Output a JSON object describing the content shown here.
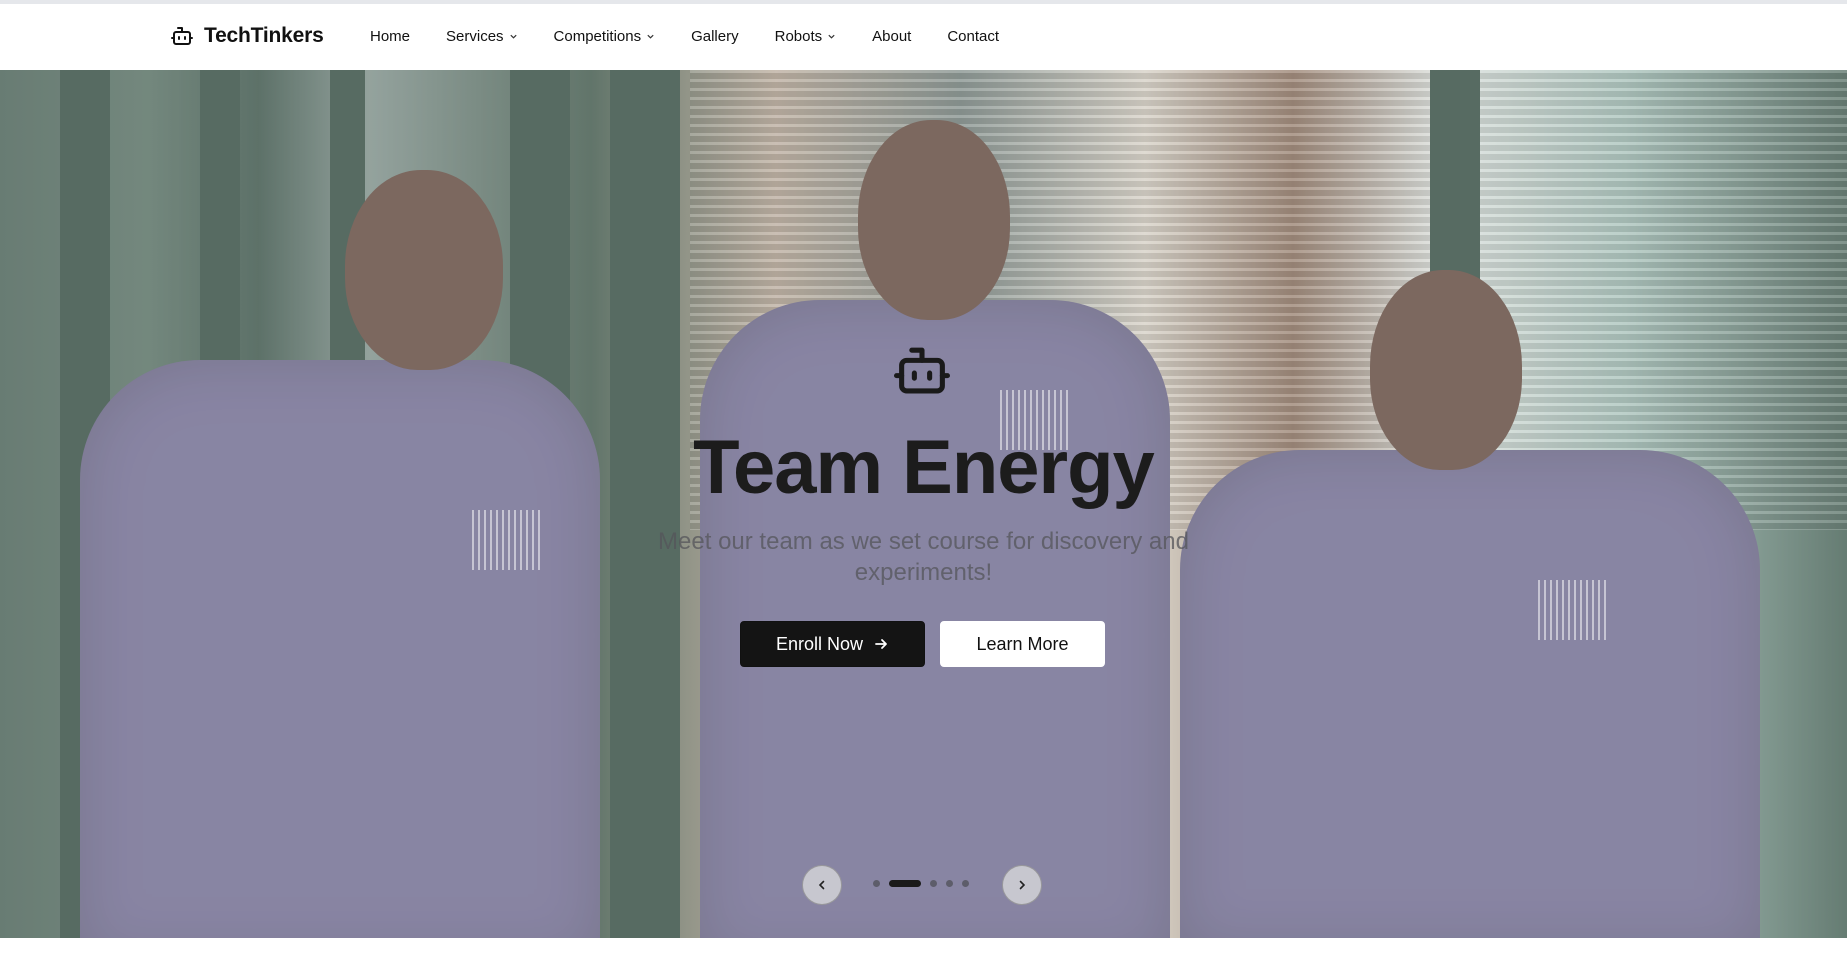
{
  "brand": {
    "name": "TechTinkers",
    "icon": "robot-icon"
  },
  "nav": {
    "items": [
      {
        "label": "Home",
        "has_dropdown": false
      },
      {
        "label": "Services",
        "has_dropdown": true
      },
      {
        "label": "Competitions",
        "has_dropdown": true
      },
      {
        "label": "Gallery",
        "has_dropdown": false
      },
      {
        "label": "Robots",
        "has_dropdown": true
      },
      {
        "label": "About",
        "has_dropdown": false
      },
      {
        "label": "Contact",
        "has_dropdown": false
      }
    ]
  },
  "hero": {
    "icon": "robot-icon",
    "title": "Team Energy",
    "subtitle": "Meet our team as we set course for discovery and experiments!",
    "primary_button": "Enroll Now",
    "secondary_button": "Learn More",
    "carousel": {
      "slide_count": 5,
      "active_index": 1
    }
  },
  "colors": {
    "primary_button_bg": "#141414",
    "secondary_button_bg": "#ffffff",
    "shirt": "#5b5680"
  }
}
